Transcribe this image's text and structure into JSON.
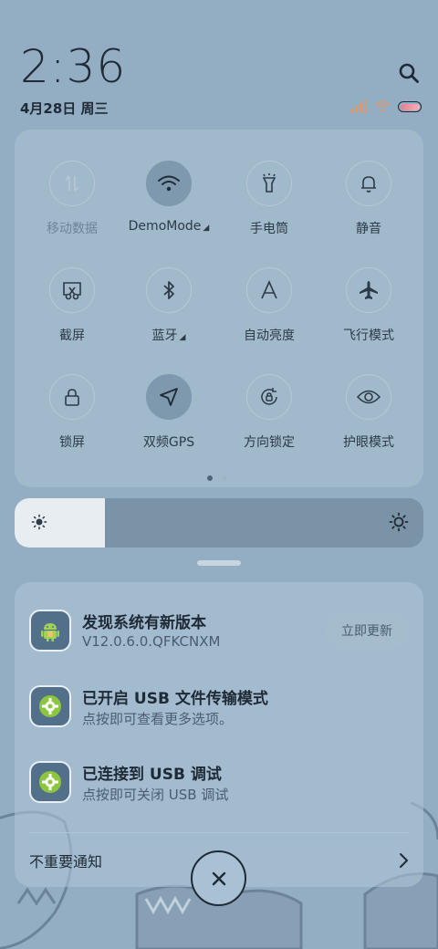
{
  "header": {
    "time": "2:36",
    "date": "4月28日 周三"
  },
  "status": {
    "signal_icon": "signal-icon",
    "wifi_icon": "wifi-icon",
    "battery_icon": "battery-icon"
  },
  "quick_settings": {
    "tiles": [
      {
        "label": "移动数据",
        "icon": "mobile-data-icon",
        "active": false,
        "dim": true
      },
      {
        "label": "DemoMode",
        "icon": "wifi-icon",
        "active": true,
        "dropdown": true
      },
      {
        "label": "手电筒",
        "icon": "flashlight-icon",
        "active": false
      },
      {
        "label": "静音",
        "icon": "bell-icon",
        "active": false
      },
      {
        "label": "截屏",
        "icon": "screenshot-icon",
        "active": false
      },
      {
        "label": "蓝牙",
        "icon": "bluetooth-icon",
        "active": false,
        "dropdown": true
      },
      {
        "label": "自动亮度",
        "icon": "auto-brightness-icon",
        "active": false
      },
      {
        "label": "飞行模式",
        "icon": "airplane-icon",
        "active": false
      },
      {
        "label": "锁屏",
        "icon": "lock-icon",
        "active": false
      },
      {
        "label": "双频GPS",
        "icon": "location-icon",
        "active": true
      },
      {
        "label": "方向锁定",
        "icon": "rotation-lock-icon",
        "active": false
      },
      {
        "label": "护眼模式",
        "icon": "eye-icon",
        "active": false
      }
    ],
    "page_count": 2,
    "current_page": 1
  },
  "brightness": {
    "level": 0.22
  },
  "notifications": {
    "items": [
      {
        "title": "发现系统有新版本",
        "subtitle": "V12.0.6.0.QFKCNXM",
        "action": "立即更新",
        "icon": "android-icon"
      },
      {
        "title": "已开启 USB 文件传输模式",
        "subtitle": "点按即可查看更多选项。",
        "icon": "settings-gear-icon"
      },
      {
        "title": "已连接到 USB 调试",
        "subtitle": "点按即可关闭 USB 调试",
        "icon": "settings-gear-icon"
      }
    ],
    "unimportant_label": "不重要通知"
  },
  "colors": {
    "background": "#93adc2",
    "panel": "#acc4d6",
    "active_tile": "#7e98ad",
    "text_dark": "#1f2a36"
  }
}
